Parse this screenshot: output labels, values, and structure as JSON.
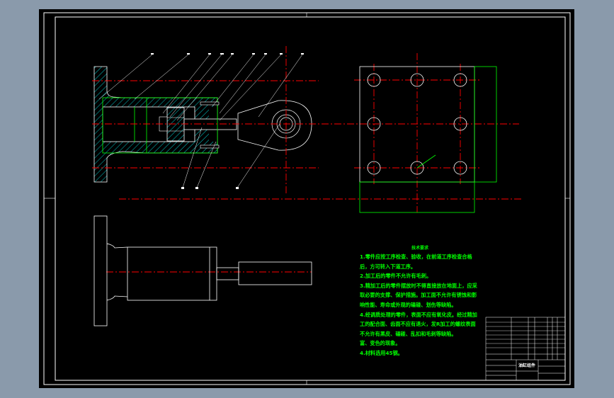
{
  "colors": {
    "background": "#8a9aab",
    "sheet": "#000000",
    "outline": "#ffffff",
    "centerline": "#ff0000",
    "hatch": "#00ffff",
    "highlight": "#00ff00"
  },
  "notes": {
    "title": "技术要求",
    "lines": [
      "1.零件应按工序检查、验收，在前道工序检查合格后，方可转入下道工序。",
      "2.加工后的零件不允许有毛刺。",
      "3.精加工后的零件摆放时不得直接放在地面上，应采取必要的支撑、保护措施。加工面不允许有锈蚀和影响性能、寿命或外观的磕碰、划伤等缺陷。",
      "4.经调质处理的零件，表面不应有氧化皮。经过精加工的配合面、齿面不应有退火，发R加工的螺纹表面不允许有黑皮、磕碰、乱扣和毛刺等缺陷。",
      "富、变色的现象。",
      "4.材料选用45钢。"
    ]
  },
  "title_block": {
    "drawing_name": "油缸组件"
  }
}
